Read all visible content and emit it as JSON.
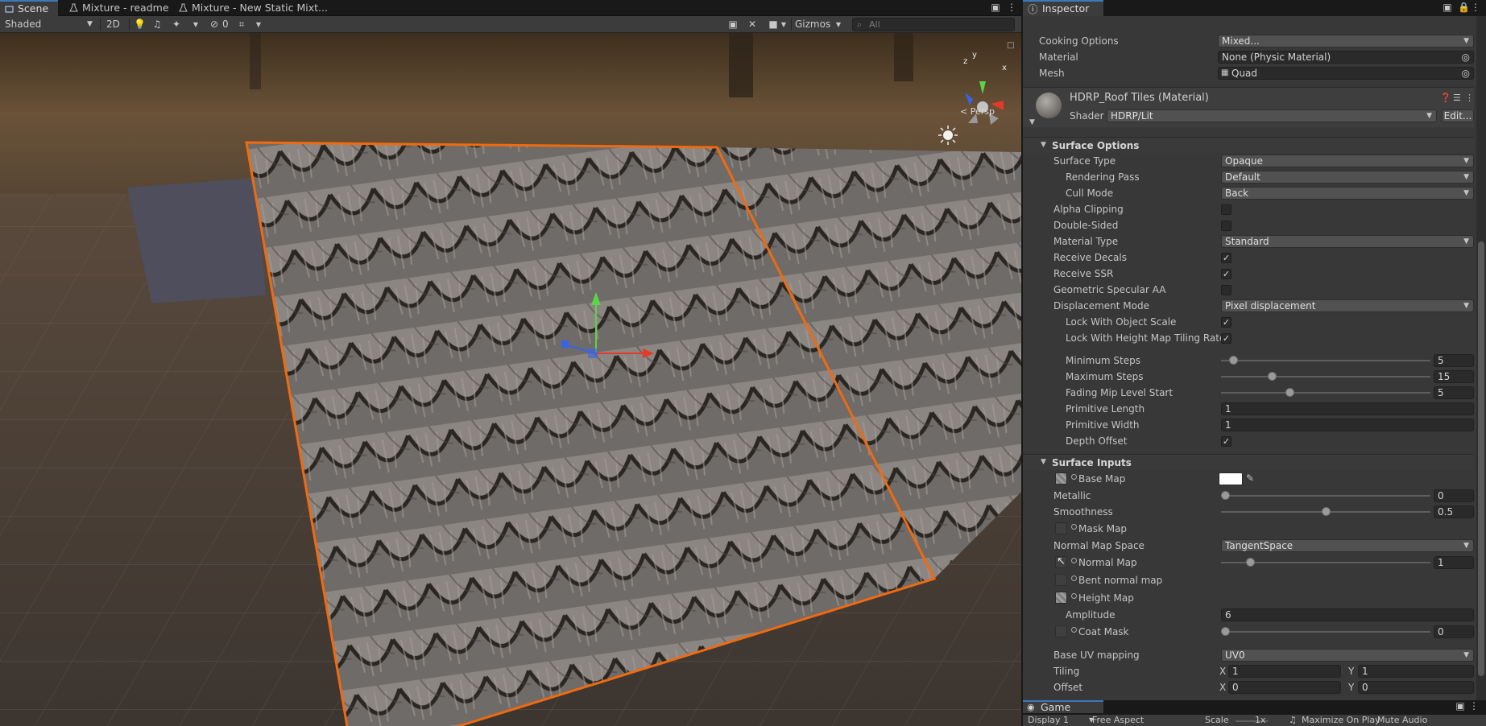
{
  "scene_tabs": [
    {
      "label": "Scene"
    },
    {
      "label": "Mixture - readme"
    },
    {
      "label": "Mixture - New Static Mixt..."
    }
  ],
  "scene_toolbar": {
    "shading_mode": "Shaded",
    "mode_2d": "2D",
    "hidden_count": "0",
    "gizmos": "Gizmos",
    "search_placeholder": "All",
    "persp_label": "< Persp",
    "axis_x": "x",
    "axis_y": "y",
    "axis_z": "z"
  },
  "inspector": {
    "title": "Inspector",
    "top_rows": [
      {
        "label": "Cooking Options",
        "value": "Mixed..."
      },
      {
        "label": "Material",
        "value": "None (Physic Material)"
      },
      {
        "label": "Mesh",
        "value": "Quad"
      }
    ],
    "material": {
      "name": "HDRP_Roof Tiles (Material)",
      "shader_label": "Shader",
      "shader_value": "HDRP/Lit",
      "edit_label": "Edit..."
    },
    "surface_options": {
      "title": "Surface Options",
      "surface_type": {
        "label": "Surface Type",
        "value": "Opaque"
      },
      "rendering_pass": {
        "label": "Rendering Pass",
        "value": "Default"
      },
      "cull_mode": {
        "label": "Cull Mode",
        "value": "Back"
      },
      "alpha_clipping": {
        "label": "Alpha Clipping",
        "checked": false
      },
      "double_sided": {
        "label": "Double-Sided",
        "checked": false
      },
      "material_type": {
        "label": "Material Type",
        "value": "Standard"
      },
      "receive_decals": {
        "label": "Receive Decals",
        "checked": true
      },
      "receive_ssr": {
        "label": "Receive SSR",
        "checked": true
      },
      "geometric_specular_aa": {
        "label": "Geometric Specular AA",
        "checked": false
      },
      "displacement_mode": {
        "label": "Displacement Mode",
        "value": "Pixel displacement"
      },
      "lock_object_scale": {
        "label": "Lock With Object Scale",
        "checked": true
      },
      "lock_height_tiling": {
        "label": "Lock With Height Map Tiling Rate",
        "checked": true
      },
      "minimum_steps": {
        "label": "Minimum Steps",
        "value": "5",
        "fraction": 0.04
      },
      "maximum_steps": {
        "label": "Maximum Steps",
        "value": "15",
        "fraction": 0.23
      },
      "fading_mip": {
        "label": "Fading Mip Level Start",
        "value": "5",
        "fraction": 0.32
      },
      "primitive_length": {
        "label": "Primitive Length",
        "value": "1"
      },
      "primitive_width": {
        "label": "Primitive Width",
        "value": "1"
      },
      "depth_offset": {
        "label": "Depth Offset",
        "checked": true
      }
    },
    "surface_inputs": {
      "title": "Surface Inputs",
      "base_map": {
        "label": "Base Map",
        "color": "#ffffff"
      },
      "metallic": {
        "label": "Metallic",
        "value": "0",
        "fraction": 0.0
      },
      "smoothness": {
        "label": "Smoothness",
        "value": "0.5",
        "fraction": 0.5
      },
      "mask_map": {
        "label": "Mask Map"
      },
      "normal_map_space": {
        "label": "Normal Map Space",
        "value": "TangentSpace"
      },
      "normal_map": {
        "label": "Normal Map",
        "value": "1",
        "fraction": 0.125
      },
      "bent_normal_map": {
        "label": "Bent normal map"
      },
      "height_map": {
        "label": "Height Map"
      },
      "amplitude": {
        "label": "Amplitude",
        "value": "6"
      },
      "coat_mask": {
        "label": "Coat Mask",
        "value": "0",
        "fraction": 0.0
      },
      "base_uv_mapping": {
        "label": "Base UV mapping",
        "value": "UV0"
      },
      "tiling": {
        "label": "Tiling",
        "x_label": "X",
        "x": "1",
        "y_label": "Y",
        "y": "1"
      },
      "offset": {
        "label": "Offset",
        "x_label": "X",
        "x": "0",
        "y_label": "Y",
        "y": "0"
      }
    }
  },
  "game_panel": {
    "tab": "Game",
    "display": "Display 1",
    "aspect": "Free Aspect",
    "scale_label": "Scale",
    "scale_value": "1x",
    "maximize": "Maximize On Play",
    "mute": "Mute Audio"
  },
  "colors": {
    "selection_outline": "#f06a10",
    "axis_x": "#e33a2a",
    "axis_y": "#5bd44a",
    "axis_z": "#3a62e8",
    "accent": "#3a79bb"
  }
}
